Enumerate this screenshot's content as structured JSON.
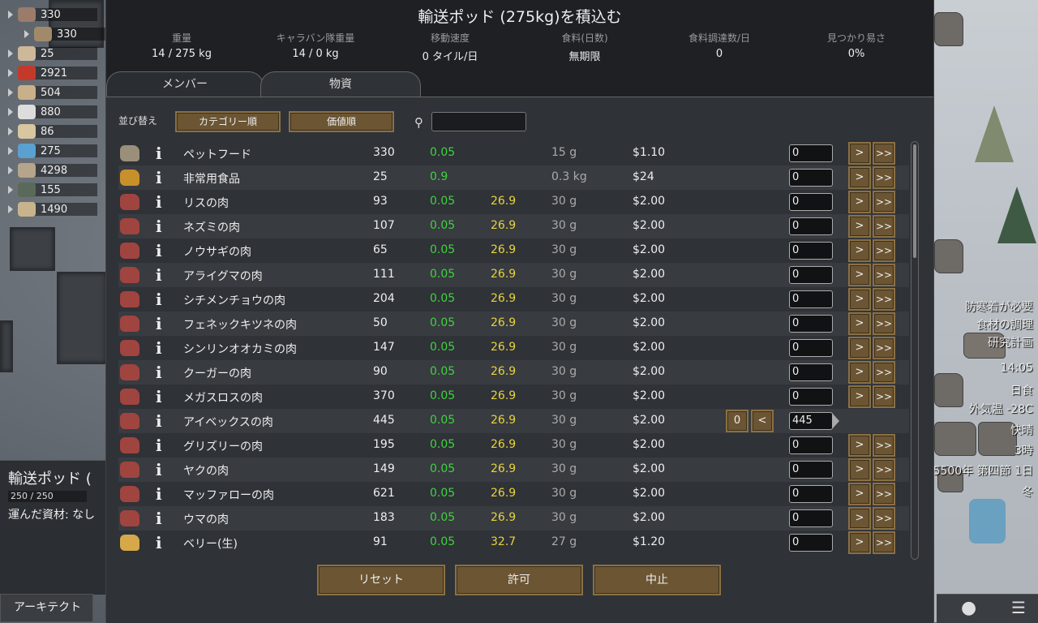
{
  "resources": [
    {
      "icon": "meat-icon",
      "value": "330",
      "color": "#9b7b6a"
    },
    {
      "icon": "pet-food-icon",
      "value": "330",
      "color": "#a08a6a"
    },
    {
      "icon": "cloth-icon",
      "value": "25",
      "color": "#cdb89a"
    },
    {
      "icon": "berries-icon",
      "value": "2921",
      "color": "#c43a2a"
    },
    {
      "icon": "wood-icon",
      "value": "504",
      "color": "#c9b08a"
    },
    {
      "icon": "paper-icon",
      "value": "880",
      "color": "#ddd"
    },
    {
      "icon": "medicine-icon",
      "value": "86",
      "color": "#d7c6a0"
    },
    {
      "icon": "pill-icon",
      "value": "275",
      "color": "#5aa0d0"
    },
    {
      "icon": "steel-icon",
      "value": "4298",
      "color": "#b5a58a"
    },
    {
      "icon": "herb-icon",
      "value": "155",
      "color": "#5a6a5a"
    },
    {
      "icon": "chunk-icon",
      "value": "1490",
      "color": "#c8b48c"
    }
  ],
  "inspect": {
    "title": "輸送ポッド (",
    "hp": "250 / 250",
    "contents": "運んだ資材: なし"
  },
  "architect_label": "アーキテクト",
  "alerts": [
    "防寒着が必要",
    "食材の調理",
    "研究計画"
  ],
  "clock": {
    "time": "14:05",
    "event": "日食",
    "temp": "外気温 -28C",
    "weather": "快晴",
    "hour": "3時",
    "date": "5500年 第四節 1日",
    "season": "冬"
  },
  "dialog": {
    "title": "輸送ポッド (275kg)を積込む",
    "stats": [
      {
        "label": "重量",
        "value": "14 / 275 kg"
      },
      {
        "label": "キャラバン隊重量",
        "value": "14 / 0 kg"
      },
      {
        "label": "移動速度",
        "value": "0 タイル/日"
      },
      {
        "label": "食料(日数)",
        "value": "無期限"
      },
      {
        "label": "食料調達数/日",
        "value": "0"
      },
      {
        "label": "見つかり易さ",
        "value": "0%"
      }
    ],
    "tabs": {
      "members": "メンバー",
      "items": "物資"
    },
    "sort_label": "並び替え",
    "sort_category": "カテゴリー順",
    "sort_value": "価値順",
    "buttons": {
      "reset": "リセット",
      "accept": "許可",
      "cancel": "中止"
    }
  },
  "items": [
    {
      "name": "ペットフード",
      "count": "330",
      "mass": "0.05",
      "nutrition": "",
      "weight": "15 g",
      "price": "$1.10",
      "qty": "0",
      "icon": "kibble-icon"
    },
    {
      "name": "非常用食品",
      "count": "25",
      "mass": "0.9",
      "nutrition": "",
      "weight": "0.3 kg",
      "price": "$24",
      "qty": "0",
      "icon": "package-icon"
    },
    {
      "name": "リスの肉",
      "count": "93",
      "mass": "0.05",
      "nutrition": "26.9",
      "weight": "30 g",
      "price": "$2.00",
      "qty": "0",
      "icon": "meat-icon"
    },
    {
      "name": "ネズミの肉",
      "count": "107",
      "mass": "0.05",
      "nutrition": "26.9",
      "weight": "30 g",
      "price": "$2.00",
      "qty": "0",
      "icon": "meat-icon"
    },
    {
      "name": "ノウサギの肉",
      "count": "65",
      "mass": "0.05",
      "nutrition": "26.9",
      "weight": "30 g",
      "price": "$2.00",
      "qty": "0",
      "icon": "meat-icon"
    },
    {
      "name": "アライグマの肉",
      "count": "111",
      "mass": "0.05",
      "nutrition": "26.9",
      "weight": "30 g",
      "price": "$2.00",
      "qty": "0",
      "icon": "meat-icon"
    },
    {
      "name": "シチメンチョウの肉",
      "count": "204",
      "mass": "0.05",
      "nutrition": "26.9",
      "weight": "30 g",
      "price": "$2.00",
      "qty": "0",
      "icon": "meat-icon"
    },
    {
      "name": "フェネックキツネの肉",
      "count": "50",
      "mass": "0.05",
      "nutrition": "26.9",
      "weight": "30 g",
      "price": "$2.00",
      "qty": "0",
      "icon": "meat-icon"
    },
    {
      "name": "シンリンオオカミの肉",
      "count": "147",
      "mass": "0.05",
      "nutrition": "26.9",
      "weight": "30 g",
      "price": "$2.00",
      "qty": "0",
      "icon": "meat-icon"
    },
    {
      "name": "クーガーの肉",
      "count": "90",
      "mass": "0.05",
      "nutrition": "26.9",
      "weight": "30 g",
      "price": "$2.00",
      "qty": "0",
      "icon": "meat-icon"
    },
    {
      "name": "メガスロスの肉",
      "count": "370",
      "mass": "0.05",
      "nutrition": "26.9",
      "weight": "30 g",
      "price": "$2.00",
      "qty": "0",
      "icon": "meat-icon"
    },
    {
      "name": "アイベックスの肉",
      "count": "445",
      "mass": "0.05",
      "nutrition": "26.9",
      "weight": "30 g",
      "price": "$2.00",
      "qty": "445",
      "icon": "meat-icon",
      "maxed": true,
      "left0": "0",
      "left1": "<"
    },
    {
      "name": "グリズリーの肉",
      "count": "195",
      "mass": "0.05",
      "nutrition": "26.9",
      "weight": "30 g",
      "price": "$2.00",
      "qty": "0",
      "icon": "meat-icon"
    },
    {
      "name": "ヤクの肉",
      "count": "149",
      "mass": "0.05",
      "nutrition": "26.9",
      "weight": "30 g",
      "price": "$2.00",
      "qty": "0",
      "icon": "meat-icon"
    },
    {
      "name": "マッファローの肉",
      "count": "621",
      "mass": "0.05",
      "nutrition": "26.9",
      "weight": "30 g",
      "price": "$2.00",
      "qty": "0",
      "icon": "meat-icon"
    },
    {
      "name": "ウマの肉",
      "count": "183",
      "mass": "0.05",
      "nutrition": "26.9",
      "weight": "30 g",
      "price": "$2.00",
      "qty": "0",
      "icon": "meat-icon"
    },
    {
      "name": "ベリー(生)",
      "count": "91",
      "mass": "0.05",
      "nutrition": "32.7",
      "weight": "27 g",
      "price": "$1.20",
      "qty": "0",
      "icon": "berry-icon"
    }
  ],
  "row_buttons": {
    "one": ">",
    "all": ">>"
  },
  "info_glyph": "i",
  "colors": {
    "button": "#6b5533",
    "mass": "#3fd33f",
    "nutrition": "#e8d43a"
  }
}
